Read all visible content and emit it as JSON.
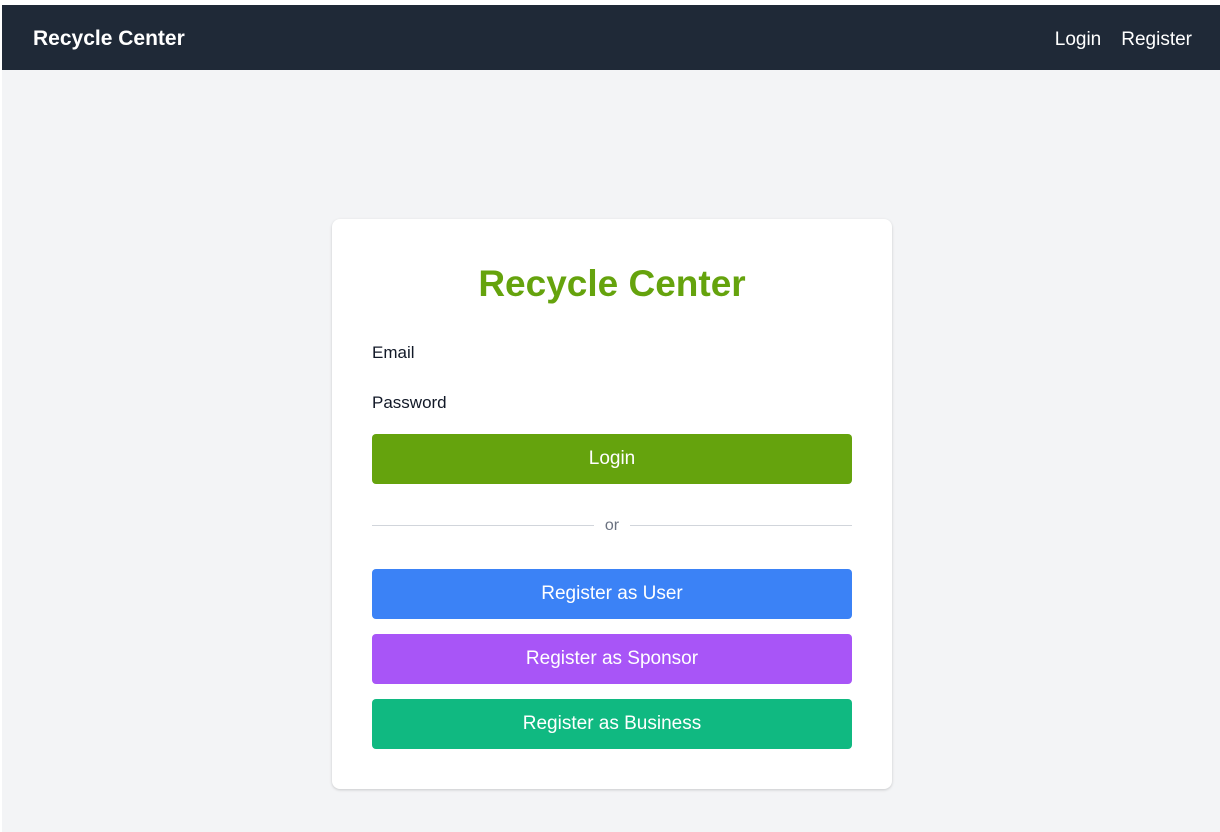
{
  "navbar": {
    "brand": "Recycle Center",
    "links": [
      {
        "label": "Login"
      },
      {
        "label": "Register"
      }
    ]
  },
  "card": {
    "title": "Recycle Center",
    "email_label": "Email",
    "password_label": "Password",
    "login_button": "Login",
    "divider_text": "or",
    "register_user_button": "Register as User",
    "register_sponsor_button": "Register as Sponsor",
    "register_business_button": "Register as Business"
  },
  "colors": {
    "navbar_bg": "#1f2937",
    "page_bg": "#f3f4f6",
    "title_green": "#65a30d",
    "login_green": "#65a30d",
    "user_blue": "#3b82f6",
    "sponsor_purple": "#a855f7",
    "business_teal": "#10b981"
  }
}
